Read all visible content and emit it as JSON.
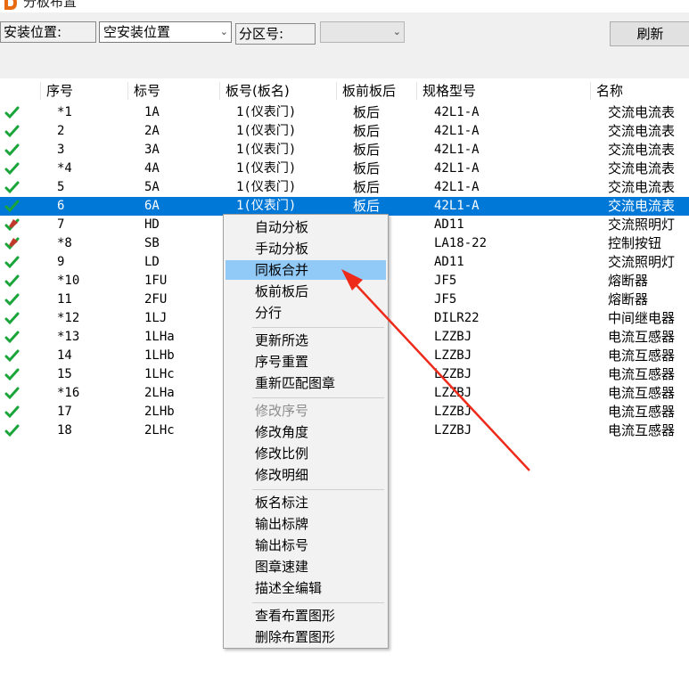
{
  "window": {
    "title": "分板布置"
  },
  "toolbar": {
    "install_label": "安装位置:",
    "install_value": "空安装位置",
    "zone_label": "分区号:",
    "zone_value": "",
    "refresh_label": "刷新"
  },
  "table": {
    "columns": [
      "序号",
      "标号",
      "板号(板名)",
      "板前板后",
      "规格型号",
      "名称"
    ],
    "rows": [
      {
        "status": "ok",
        "seq": "*1",
        "mark": "1A",
        "board": "1(仪表门)",
        "side": "板后",
        "spec": "42L1-A",
        "name": "交流电流表"
      },
      {
        "status": "ok",
        "seq": "2",
        "mark": "2A",
        "board": "1(仪表门)",
        "side": "板后",
        "spec": "42L1-A",
        "name": "交流电流表"
      },
      {
        "status": "ok",
        "seq": "3",
        "mark": "3A",
        "board": "1(仪表门)",
        "side": "板后",
        "spec": "42L1-A",
        "name": "交流电流表"
      },
      {
        "status": "ok",
        "seq": "*4",
        "mark": "4A",
        "board": "1(仪表门)",
        "side": "板后",
        "spec": "42L1-A",
        "name": "交流电流表"
      },
      {
        "status": "ok",
        "seq": "5",
        "mark": "5A",
        "board": "1(仪表门)",
        "side": "板后",
        "spec": "42L1-A",
        "name": "交流电流表"
      },
      {
        "status": "ok",
        "seq": "6",
        "mark": "6A",
        "board": "1(仪表门)",
        "side": "板后",
        "spec": "42L1-A",
        "name": "交流电流表"
      },
      {
        "status": "warn",
        "seq": "7",
        "mark": "HD",
        "board": "",
        "side": "",
        "spec": "AD11",
        "name": "交流照明灯"
      },
      {
        "status": "warn",
        "seq": "*8",
        "mark": "SB",
        "board": "",
        "side": "",
        "spec": "LA18-22",
        "name": "控制按钮"
      },
      {
        "status": "ok",
        "seq": "9",
        "mark": "LD",
        "board": "",
        "side": "",
        "spec": "AD11",
        "name": "交流照明灯"
      },
      {
        "status": "ok",
        "seq": "*10",
        "mark": "1FU",
        "board": "",
        "side": "",
        "spec": "JF5",
        "name": "熔断器"
      },
      {
        "status": "ok",
        "seq": "11",
        "mark": "2FU",
        "board": "",
        "side": "",
        "spec": "JF5",
        "name": "熔断器"
      },
      {
        "status": "ok",
        "seq": "*12",
        "mark": "1LJ",
        "board": "",
        "side": "",
        "spec": "DILR22",
        "name": "中间继电器"
      },
      {
        "status": "ok",
        "seq": "*13",
        "mark": "1LHa",
        "board": "",
        "side": "",
        "spec": "LZZBJ",
        "name": "电流互感器"
      },
      {
        "status": "ok",
        "seq": "14",
        "mark": "1LHb",
        "board": "",
        "side": "",
        "spec": "LZZBJ",
        "name": "电流互感器"
      },
      {
        "status": "ok",
        "seq": "15",
        "mark": "1LHc",
        "board": "",
        "side": "",
        "spec": "LZZBJ",
        "name": "电流互感器"
      },
      {
        "status": "ok",
        "seq": "*16",
        "mark": "2LHa",
        "board": "",
        "side": "",
        "spec": "LZZBJ",
        "name": "电流互感器"
      },
      {
        "status": "ok",
        "seq": "17",
        "mark": "2LHb",
        "board": "",
        "side": "",
        "spec": "LZZBJ",
        "name": "电流互感器"
      },
      {
        "status": "ok",
        "seq": "18",
        "mark": "2LHc",
        "board": "",
        "side": "",
        "spec": "LZZBJ",
        "name": "电流互感器"
      }
    ],
    "selected_index": 5
  },
  "context_menu": {
    "groups": [
      [
        {
          "label": "自动分板"
        },
        {
          "label": "手动分板"
        },
        {
          "label": "同板合并",
          "highlighted": true
        },
        {
          "label": "板前板后"
        },
        {
          "label": "分行"
        }
      ],
      [
        {
          "label": "更新所选"
        },
        {
          "label": "序号重置"
        },
        {
          "label": "重新匹配图章"
        }
      ],
      [
        {
          "label": "修改序号",
          "disabled": true
        },
        {
          "label": "修改角度"
        },
        {
          "label": "修改比例"
        },
        {
          "label": "修改明细"
        }
      ],
      [
        {
          "label": "板名标注"
        },
        {
          "label": "输出标牌"
        },
        {
          "label": "输出标号"
        },
        {
          "label": "图章速建"
        },
        {
          "label": "描述全编辑"
        }
      ],
      [
        {
          "label": "查看布置图形"
        },
        {
          "label": "删除布置图形"
        }
      ]
    ]
  },
  "colors": {
    "selection": "#0078d7",
    "menu_highlight": "#91c9f7",
    "ok_check": "#1aa53a",
    "arrow": "#ee2a1b"
  },
  "icons": {
    "ok": "green-check-icon",
    "warn": "check-pencil-icon",
    "logo": "app-logo-icon"
  }
}
